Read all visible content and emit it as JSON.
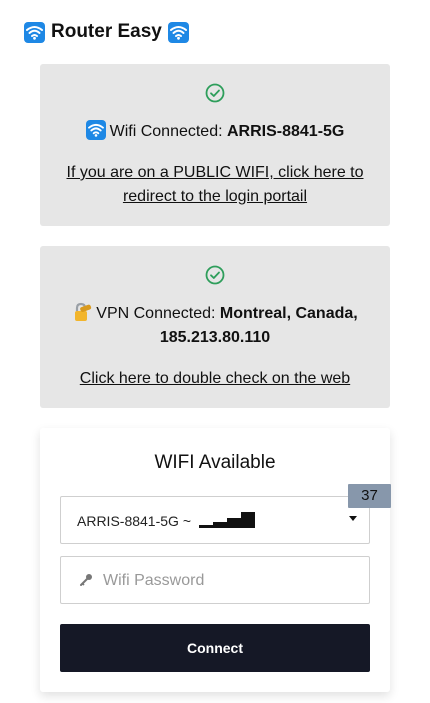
{
  "app": {
    "title": "Router Easy"
  },
  "wifi_status": {
    "prefix": "Wifi Connected: ",
    "network": "ARRIS-8841-5G",
    "link_text": "If you are on a PUBLIC WIFI, click here to redirect to the login portail"
  },
  "vpn_status": {
    "prefix": "VPN Connected: ",
    "location": "Montreal, Canada,",
    "ip": "185.213.80.110",
    "link_text": "Click here to double check on the web"
  },
  "wifi_panel": {
    "title": "WIFI Available",
    "count_badge": "37",
    "selected_network": "ARRIS-8841-5G ~ ",
    "signal_level": 4,
    "password_placeholder": "Wifi Password",
    "password_value": "",
    "connect_label": "Connect"
  },
  "colors": {
    "card_bg": "#e6e6e6",
    "check_green": "#2e9e5b",
    "button_bg": "#151826",
    "badge_bg": "#8797ab",
    "wifi_blue": "#1e88e5"
  },
  "icons": [
    "wifi-icon",
    "check-circle-icon",
    "lock-icon",
    "key-icon",
    "chevron-down-icon"
  ]
}
